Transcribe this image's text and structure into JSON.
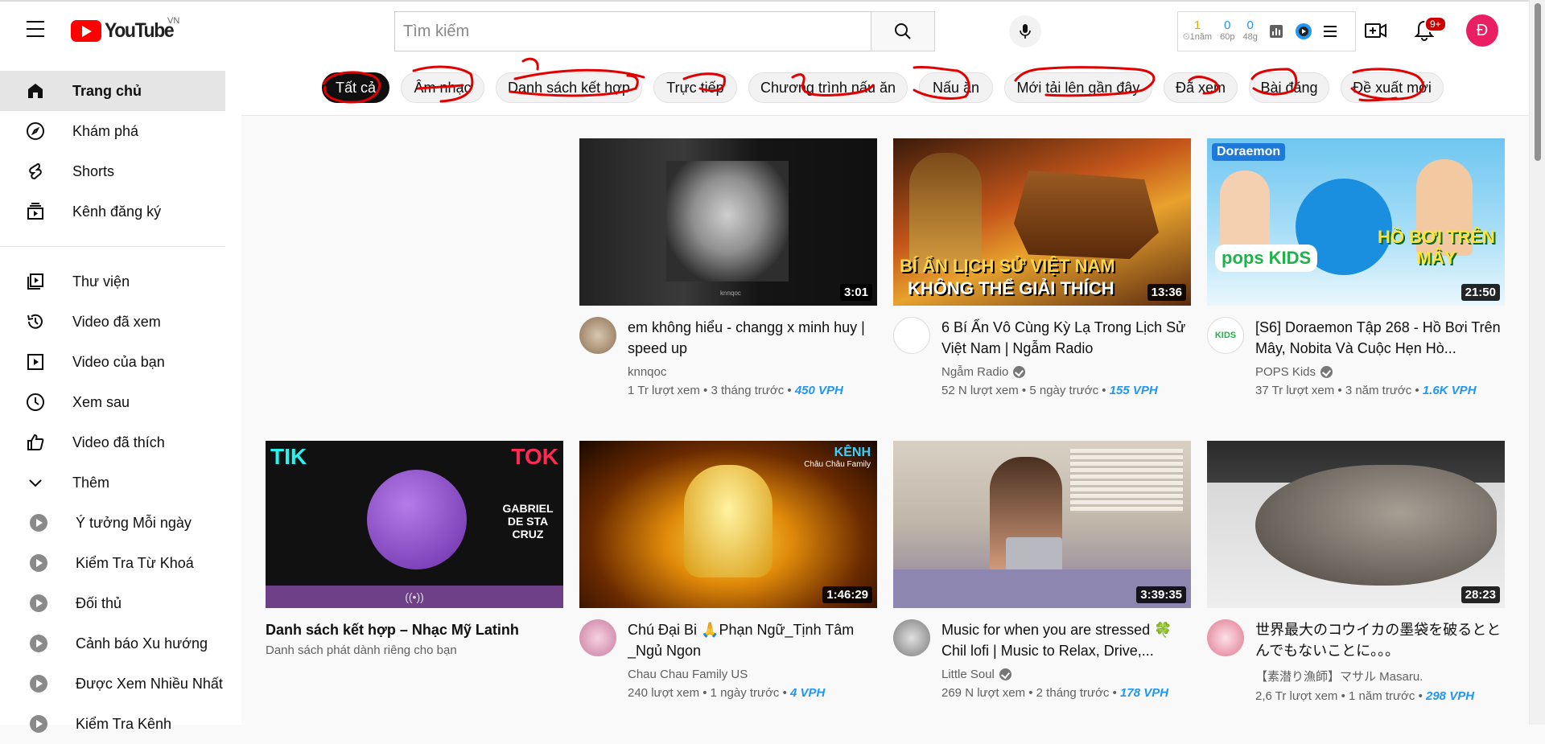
{
  "header": {
    "logo_text": "YouTube",
    "country": "VN",
    "search_placeholder": "Tìm kiếm",
    "ext": {
      "s1_value": "1",
      "s1_label": "⏲1năm",
      "s2_value": "0",
      "s2_label": "60p",
      "s3_value": "0",
      "s3_label": "48g"
    },
    "notifications_badge": "9+",
    "avatar_letter": "Đ",
    "colors": {
      "brand": "#ff0000",
      "avatar": "#e91e63",
      "vph": "#2196f3",
      "annotation": "#e00000"
    }
  },
  "sidebar": {
    "main": [
      {
        "label": "Trang chủ",
        "icon": "home-icon"
      },
      {
        "label": "Khám phá",
        "icon": "compass-icon"
      },
      {
        "label": "Shorts",
        "icon": "shorts-icon"
      },
      {
        "label": "Kênh đăng ký",
        "icon": "subscriptions-icon"
      }
    ],
    "library": [
      {
        "label": "Thư viện",
        "icon": "library-icon"
      },
      {
        "label": "Video đã xem",
        "icon": "history-icon"
      },
      {
        "label": "Video của bạn",
        "icon": "your-videos-icon"
      },
      {
        "label": "Xem sau",
        "icon": "watch-later-icon"
      },
      {
        "label": "Video đã thích",
        "icon": "like-icon"
      },
      {
        "label": "Thêm",
        "icon": "chevron-down-icon"
      }
    ],
    "subs": [
      {
        "label": "Ý tưởng Mỗi ngày"
      },
      {
        "label": "Kiểm Tra Từ Khoá"
      },
      {
        "label": "Đối thủ"
      },
      {
        "label": "Cảnh báo Xu hướng"
      },
      {
        "label": "Được Xem Nhiều Nhất"
      },
      {
        "label": "Kiểm Tra Kênh"
      }
    ]
  },
  "chips": [
    "Tất cả",
    "Âm nhạc",
    "Danh sách kết hợp",
    "Trực tiếp",
    "Chương trình nấu ăn",
    "Nấu ăn",
    "Mới tải lên gần đây",
    "Đã xem",
    "Bài đăng",
    "Đề xuất mới"
  ],
  "videos": [
    {
      "title": "em không hiểu - changg x minh huy | speed up",
      "channel": "knnqoc",
      "views": "1 Tr lượt xem",
      "age": "3 tháng trước",
      "vph": "450 VPH",
      "duration": "3:01",
      "verified": false,
      "thumb_text": "knnqoc"
    },
    {
      "title": "6 Bí Ẩn Vô Cùng Kỳ Lạ Trong Lịch Sử Việt Nam | Ngẫm Radio",
      "channel": "Ngẫm Radio",
      "views": "52 N lượt xem",
      "age": "5 ngày trước",
      "vph": "155 VPH",
      "duration": "13:36",
      "verified": true,
      "thumb_text_1": "BÍ ẨN LỊCH SỬ VIỆT NAM",
      "thumb_text_2": "KHÔNG THỂ GIẢI THÍCH"
    },
    {
      "title": "[S6] Doraemon Tập 268 - Hồ Bơi Trên Mây, Nobita Và Cuộc Hẹn Hò...",
      "channel": "POPS Kids",
      "views": "37 Tr lượt xem",
      "age": "3 năm trước",
      "vph": "1.6K VPH",
      "duration": "21:50",
      "verified": true,
      "thumb_text_1": "Doraemon",
      "thumb_text_2": "HỒ BƠI TRÊN MÂY",
      "thumb_text_3": "pops KIDS"
    },
    {
      "title": "Danh sách kết hợp – Nhạc Mỹ Latinh",
      "subtitle": "Danh sách phát dành riêng cho bạn",
      "thumb_text_1": "TIK",
      "thumb_text_2": "TOK",
      "thumb_text_3": "GABRIEL DE STA CRUZ"
    },
    {
      "title": "Chú Đại Bi 🙏Phạn Ngữ_Tịnh Tâm _Ngủ Ngon",
      "channel": "Chau Chau Family US",
      "views": "240 lượt xem",
      "age": "1 ngày trước",
      "vph": "4 VPH",
      "duration": "1:46:29",
      "verified": false,
      "thumb_text_1": "KÊNH",
      "thumb_text_2": "Châu Châu Family"
    },
    {
      "title": "Music for when you are stressed 🍀 Chil lofi | Music to Relax, Drive,...",
      "channel": "Little Soul",
      "views": "269 N lượt xem",
      "age": "2 tháng trước",
      "vph": "178 VPH",
      "duration": "3:39:35",
      "verified": true
    },
    {
      "title": "世界最大のコウイカの墨袋を破るととんでもないことに。。。",
      "channel": "【素潜り漁師】マサル Masaru.",
      "views": "2,6 Tr lượt xem",
      "age": "1 năm trước",
      "vph": "298 VPH",
      "duration": "28:23",
      "verified": false
    }
  ]
}
